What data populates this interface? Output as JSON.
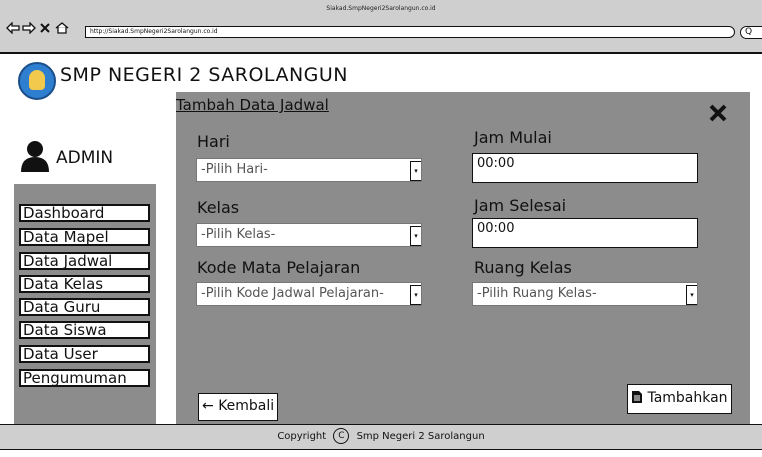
{
  "window": {
    "title": "Siakad.SmpNegeri2Sarolangun.co.id"
  },
  "browser": {
    "url": "http://Siakad.SmpNegeri2Sarolangun.co.id",
    "search_glyph": "Q",
    "icons": [
      "back-arrow-icon",
      "forward-arrow-icon",
      "stop-icon",
      "home-icon"
    ]
  },
  "app": {
    "title": "SMP NEGERI 2 SAROLANGUN"
  },
  "user": {
    "name": "ADMIN",
    "icon": "user-icon"
  },
  "sidebar": {
    "items": [
      {
        "label": "Dashboard"
      },
      {
        "label": "Data Mapel"
      },
      {
        "label": "Data Jadwal"
      },
      {
        "label": "Data Kelas"
      },
      {
        "label": "Data Guru"
      },
      {
        "label": "Data Siswa"
      },
      {
        "label": "Data User"
      },
      {
        "label": "Pengumuman"
      }
    ]
  },
  "form": {
    "title": "Tambah Data Jadwal",
    "hari": {
      "label": "Hari",
      "placeholder": "-Pilih Hari-"
    },
    "kelas": {
      "label": "Kelas",
      "placeholder": "-Pilih Kelas-"
    },
    "kode": {
      "label": "Kode Mata Pelajaran",
      "placeholder": "-Pilih Kode Jadwal Pelajaran-"
    },
    "jam_mulai": {
      "label": "Jam Mulai",
      "value": "00:00"
    },
    "jam_selesai": {
      "label": "Jam Selesai",
      "value": "00:00"
    },
    "ruang": {
      "label": "Ruang Kelas",
      "placeholder": "-Pilih Ruang Kelas-"
    },
    "back_button": {
      "label": "Kembali",
      "icon": "arrow-left-icon"
    },
    "submit_button": {
      "label": "Tambahkan",
      "icon": "document-icon"
    },
    "close_icon": "close-icon"
  },
  "footer": {
    "copyright_label": "Copyright",
    "org": "Smp Negeri 2 Sarolangun"
  },
  "colors": {
    "panel": "#8c8c8c",
    "chrome": "#cfcfcf",
    "logo": "#2f7fd0"
  }
}
